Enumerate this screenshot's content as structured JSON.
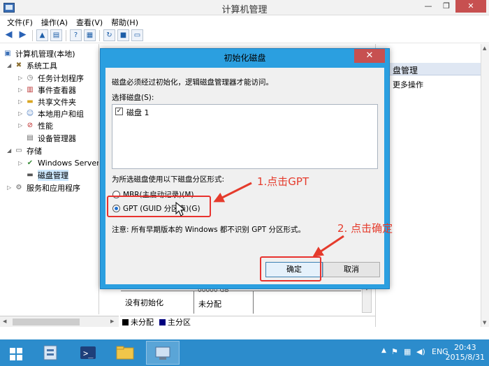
{
  "window": {
    "title": "计算机管理",
    "min": "—",
    "max": "❐",
    "close": "✕"
  },
  "menu": [
    "文件(F)",
    "操作(A)",
    "查看(V)",
    "帮助(H)"
  ],
  "tree": {
    "root": "计算机管理(本地)",
    "system_tools": "系统工具",
    "task_scheduler": "任务计划程序",
    "event_viewer": "事件查看器",
    "shared_folders": "共享文件夹",
    "local_users": "本地用户和组",
    "performance": "性能",
    "device_manager": "设备管理器",
    "storage": "存储",
    "windows_server": "Windows Server",
    "disk_management": "磁盘管理",
    "services": "服务和应用程序"
  },
  "actions": {
    "header": "盘管理",
    "more": "更多操作"
  },
  "disk_table": {
    "row_label": "没有初始化",
    "unallocated": "未分配",
    "partial_size": "00000 GB"
  },
  "legend": {
    "unallocated": "未分配",
    "primary": "主分区",
    "unallocated_color": "#000000",
    "primary_color": "#00007f"
  },
  "dialog": {
    "title": "初始化磁盘",
    "close": "✕",
    "intro": "磁盘必须经过初始化，逻辑磁盘管理器才能访问。",
    "select_label": "选择磁盘(S):",
    "disk_item": "磁盘 1",
    "disk_checked": "✓",
    "partition_label": "为所选磁盘使用以下磁盘分区形式:",
    "mbr": "MBR(主启动记录)(M)",
    "gpt": "GPT (GUID 分区表)(G)",
    "note": "注意: 所有早期版本的 Windows 都不识别 GPT 分区形式。",
    "ok": "确定",
    "cancel": "取消"
  },
  "annotations": {
    "step1": "1.点击GPT",
    "step2": "2. 点击确定",
    "color": "#e53b2c"
  },
  "taskbar": {
    "lang": "ENG",
    "time": "20:43",
    "date": "2015/8/31"
  }
}
